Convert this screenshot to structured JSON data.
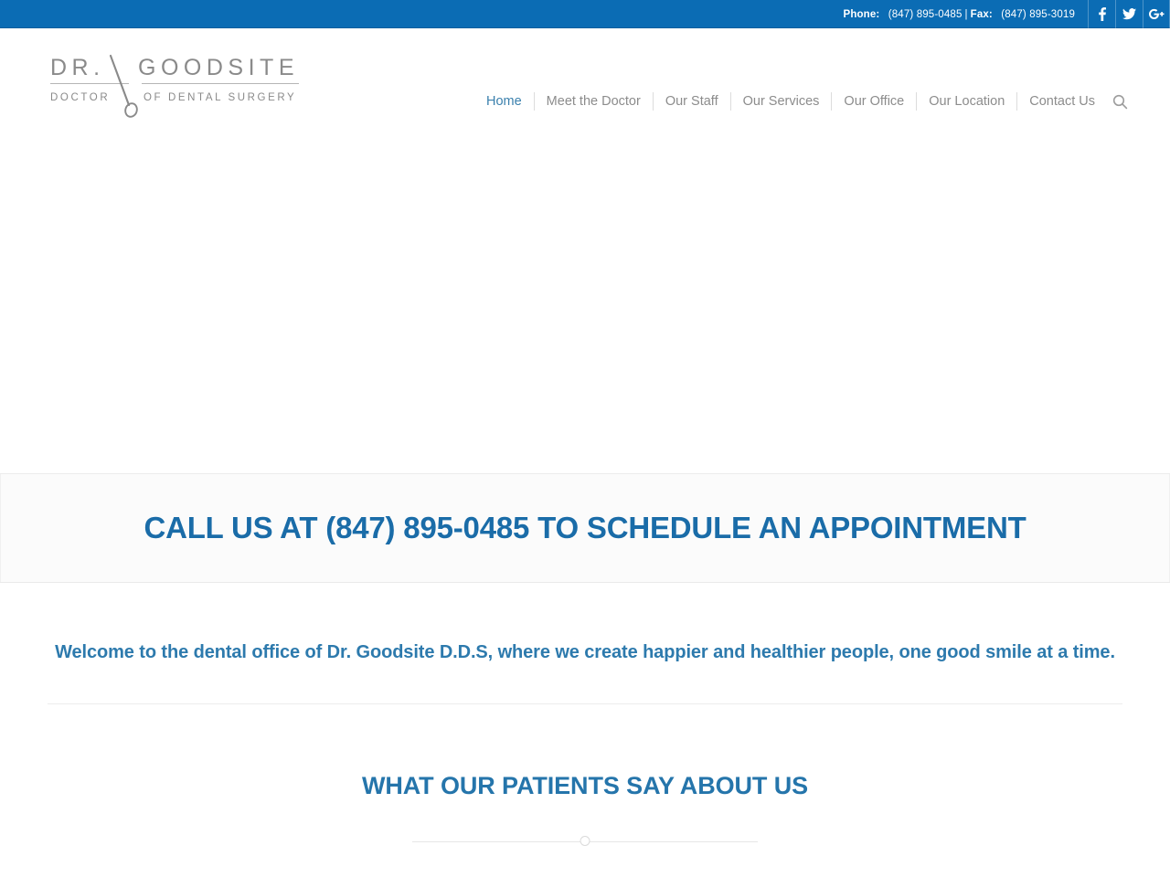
{
  "topbar": {
    "phone_label": "Phone:",
    "phone_value": "(847) 895-0485",
    "separator": "|",
    "fax_label": "Fax:",
    "fax_value": "(847) 895-3019",
    "social": [
      {
        "name": "facebook",
        "glyph": "f"
      },
      {
        "name": "twitter",
        "glyph": "t"
      },
      {
        "name": "google-plus",
        "glyph": "g+"
      }
    ],
    "background_color": "#0b6cb4"
  },
  "logo": {
    "title_part1": "DR.",
    "title_part2": "GOODSITE",
    "subtitle_part1": "DOCTOR",
    "subtitle_part2": "OF DENTAL SURGERY",
    "color": "#8a8a8a"
  },
  "nav": {
    "items": [
      {
        "label": "Home",
        "active": true
      },
      {
        "label": "Meet the Doctor",
        "active": false
      },
      {
        "label": "Our Staff",
        "active": false
      },
      {
        "label": "Our Services",
        "active": false
      },
      {
        "label": "Our Office",
        "active": false
      },
      {
        "label": "Our Location",
        "active": false
      },
      {
        "label": "Contact Us",
        "active": false
      }
    ],
    "search_icon": "search-icon",
    "active_color": "#3a80ad",
    "inactive_color": "#8c8c8c"
  },
  "cta": {
    "heading": "CALL US AT (847) 895-0485 TO SCHEDULE AN APPOINTMENT",
    "color": "#1a6ca8",
    "background_color": "#fbfbfb"
  },
  "welcome": {
    "text": "Welcome to the dental office of Dr. Goodsite D.D.S, where we create happier and healthier people, one good smile at a time.",
    "color": "#2d7aad"
  },
  "testimonials": {
    "heading": "WHAT OUR PATIENTS SAY ABOUT US",
    "color": "#2575ab"
  }
}
